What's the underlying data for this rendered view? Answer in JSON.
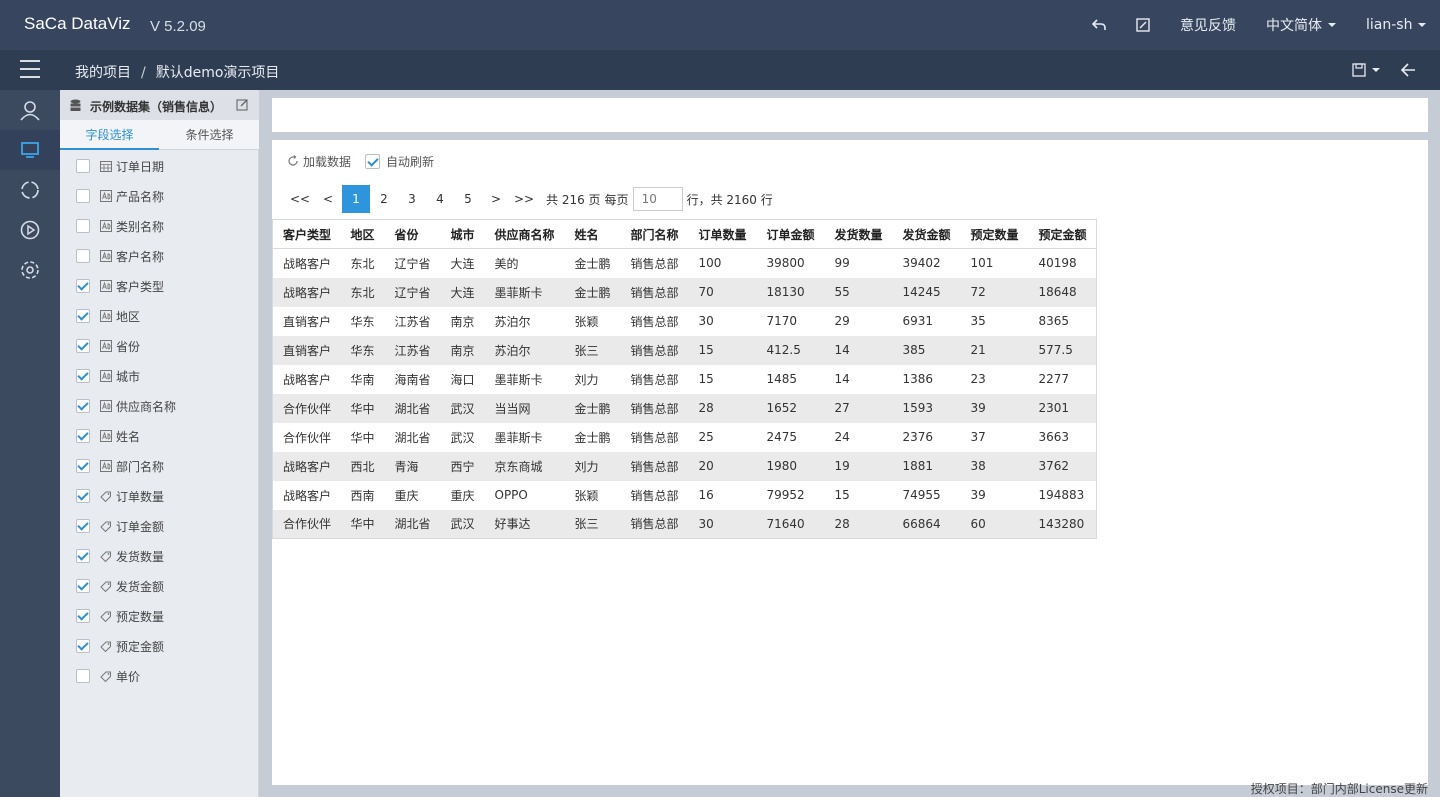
{
  "app": {
    "logo": "SaCa DataViz",
    "version": "V 5.2.09",
    "feedback": "意见反馈",
    "language": "中文简体",
    "user": "lian-sh"
  },
  "breadcrumb": {
    "root": "我的项目",
    "separator": "/",
    "current": "默认demo演示项目"
  },
  "dataset": {
    "title": "示例数据集（销售信息）",
    "tabs": [
      "字段选择",
      "条件选择"
    ],
    "fields": [
      {
        "label": "订单日期",
        "checked": false,
        "type": "date"
      },
      {
        "label": "产品名称",
        "checked": false,
        "type": "text"
      },
      {
        "label": "类别名称",
        "checked": false,
        "type": "text"
      },
      {
        "label": "客户名称",
        "checked": false,
        "type": "text"
      },
      {
        "label": "客户类型",
        "checked": true,
        "type": "text"
      },
      {
        "label": "地区",
        "checked": true,
        "type": "text"
      },
      {
        "label": "省份",
        "checked": true,
        "type": "text"
      },
      {
        "label": "城市",
        "checked": true,
        "type": "text"
      },
      {
        "label": "供应商名称",
        "checked": true,
        "type": "text"
      },
      {
        "label": "姓名",
        "checked": true,
        "type": "text"
      },
      {
        "label": "部门名称",
        "checked": true,
        "type": "text"
      },
      {
        "label": "订单数量",
        "checked": true,
        "type": "number"
      },
      {
        "label": "订单金额",
        "checked": true,
        "type": "number"
      },
      {
        "label": "发货数量",
        "checked": true,
        "type": "number"
      },
      {
        "label": "发货金额",
        "checked": true,
        "type": "number"
      },
      {
        "label": "预定数量",
        "checked": true,
        "type": "number"
      },
      {
        "label": "预定金额",
        "checked": true,
        "type": "number"
      },
      {
        "label": "单价",
        "checked": false,
        "type": "number"
      }
    ]
  },
  "toolbar": {
    "load": "加载数据",
    "auto_refresh": "自动刷新"
  },
  "pager": {
    "first": "<<",
    "prev": "<",
    "pages": [
      "1",
      "2",
      "3",
      "4",
      "5"
    ],
    "next": ">",
    "last": ">>",
    "total_pages": "共 216 页",
    "per_page_label": "每页",
    "per_page_value": "10",
    "total_rows": "行，共 2160 行"
  },
  "table": {
    "columns": [
      "客户类型",
      "地区",
      "省份",
      "城市",
      "供应商名称",
      "姓名",
      "部门名称",
      "订单数量",
      "订单金额",
      "发货数量",
      "发货金额",
      "预定数量",
      "预定金额"
    ],
    "rows": [
      [
        "战略客户",
        "东北",
        "辽宁省",
        "大连",
        "美的",
        "金士鹏",
        "销售总部",
        "100",
        "39800",
        "99",
        "39402",
        "101",
        "40198"
      ],
      [
        "战略客户",
        "东北",
        "辽宁省",
        "大连",
        "墨菲斯卡",
        "金士鹏",
        "销售总部",
        "70",
        "18130",
        "55",
        "14245",
        "72",
        "18648"
      ],
      [
        "直销客户",
        "华东",
        "江苏省",
        "南京",
        "苏泊尔",
        "张颖",
        "销售总部",
        "30",
        "7170",
        "29",
        "6931",
        "35",
        "8365"
      ],
      [
        "直销客户",
        "华东",
        "江苏省",
        "南京",
        "苏泊尔",
        "张三",
        "销售总部",
        "15",
        "412.5",
        "14",
        "385",
        "21",
        "577.5"
      ],
      [
        "战略客户",
        "华南",
        "海南省",
        "海口",
        "墨菲斯卡",
        "刘力",
        "销售总部",
        "15",
        "1485",
        "14",
        "1386",
        "23",
        "2277"
      ],
      [
        "合作伙伴",
        "华中",
        "湖北省",
        "武汉",
        "当当网",
        "金士鹏",
        "销售总部",
        "28",
        "1652",
        "27",
        "1593",
        "39",
        "2301"
      ],
      [
        "合作伙伴",
        "华中",
        "湖北省",
        "武汉",
        "墨菲斯卡",
        "金士鹏",
        "销售总部",
        "25",
        "2475",
        "24",
        "2376",
        "37",
        "3663"
      ],
      [
        "战略客户",
        "西北",
        "青海",
        "西宁",
        "京东商城",
        "刘力",
        "销售总部",
        "20",
        "1980",
        "19",
        "1881",
        "38",
        "3762"
      ],
      [
        "战略客户",
        "西南",
        "重庆",
        "重庆",
        "OPPO",
        "张颖",
        "销售总部",
        "16",
        "79952",
        "15",
        "74955",
        "39",
        "194883"
      ],
      [
        "合作伙伴",
        "华中",
        "湖北省",
        "武汉",
        "好事达",
        "张三",
        "销售总部",
        "30",
        "71640",
        "28",
        "66864",
        "60",
        "143280"
      ]
    ]
  },
  "license": "授权项目：部门内部License更新"
}
